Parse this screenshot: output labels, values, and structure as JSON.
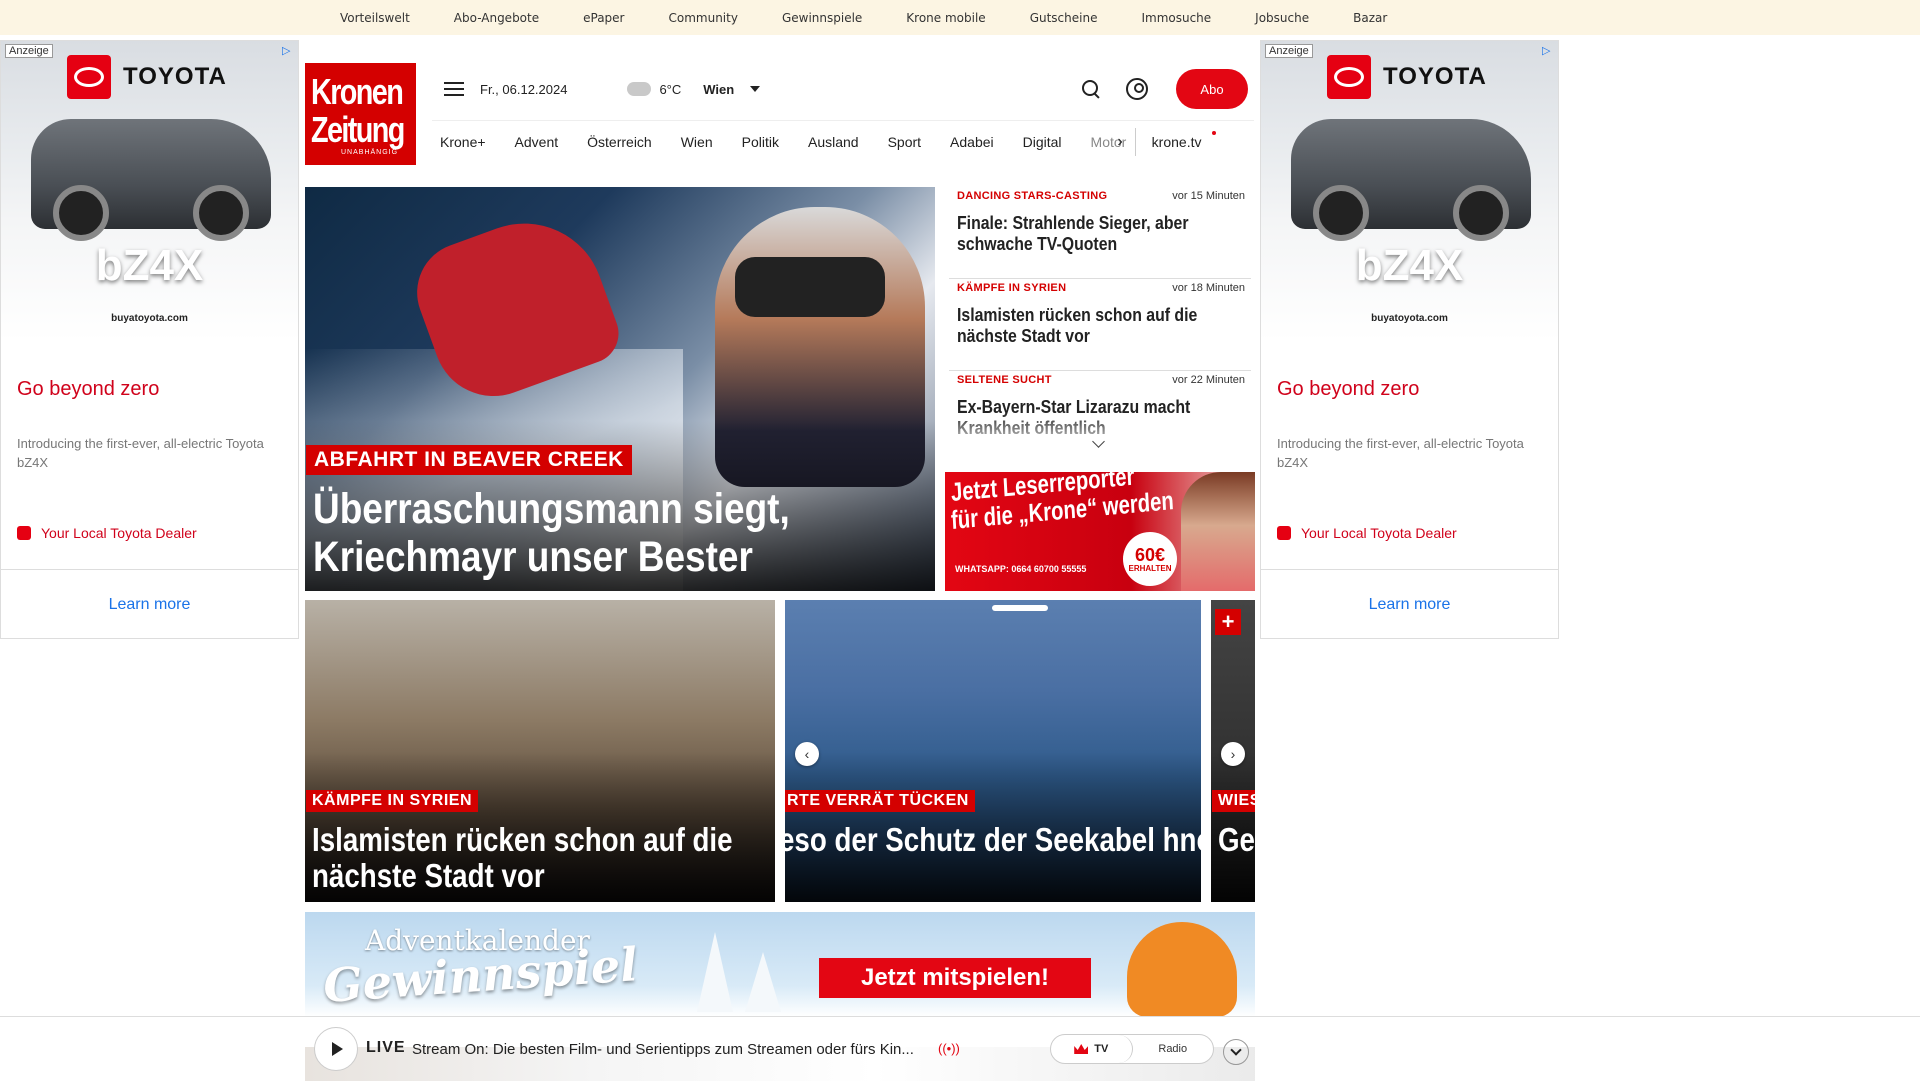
{
  "topbar": {
    "links": [
      "Vorteilswelt",
      "Abo-Angebote",
      "ePaper",
      "Community",
      "Gewinnspiele",
      "Krone mobile",
      "Gutscheine",
      "Immosuche",
      "Jobsuche",
      "Bazar"
    ]
  },
  "ad": {
    "label": "Anzeige",
    "brand": "TOYOTA",
    "model": "bZ4X",
    "url_text": "buyatoyota.com",
    "headline": "Go beyond zero",
    "description": "Introducing the first-ever, all-electric Toyota bZ4X",
    "dealer": "Your Local Toyota Dealer",
    "cta": "Learn more"
  },
  "header": {
    "logo_line1": "Kronen",
    "logo_line2": "Zeitung",
    "logo_tagline": "UNABHÄNGIG",
    "date": "Fr., 06.12.2024",
    "temperature": "6°C",
    "city": "Wien",
    "abo_label": "Abo"
  },
  "nav": {
    "items": [
      "Krone+",
      "Advent",
      "Österreich",
      "Wien",
      "Politik",
      "Ausland",
      "Sport",
      "Adabei",
      "Digital"
    ],
    "truncated": "Motor",
    "tv": "krone.tv"
  },
  "hero": {
    "kicker": "ABFAHRT IN BEAVER CREEK",
    "title": "Überraschungsmann siegt, Kriechmayr unser Bester"
  },
  "side_news": [
    {
      "category": "DANCING STARS-CASTING",
      "time": "vor 15 Minuten",
      "title": "Finale: Strahlende Sieger, aber schwache TV-Quoten"
    },
    {
      "category": "KÄMPFE IN SYRIEN",
      "time": "vor 18 Minuten",
      "title": "Islamisten rücken schon auf die nächste Stadt vor"
    },
    {
      "category": "SELTENE SUCHT",
      "time": "vor 22 Minuten",
      "title": "Ex-Bayern-Star Lizarazu macht Krankheit öffentlich"
    }
  ],
  "promo": {
    "line1": "Jetzt Leserreporter",
    "line2": "für die „Krone“ werden",
    "whatsapp": "WHATSAPP: 0664 60700 55555",
    "badge_amount": "60€",
    "badge_text": "ERHALTEN"
  },
  "cards": [
    {
      "kicker": "KÄMPFE IN SYRIEN",
      "title": "Islamisten rücken schon auf die nächste Stadt vor"
    },
    {
      "kicker": "RTE VERRÄT TÜCKEN",
      "title": "eso der Schutz der Seekabel hnologisch ein Albtraum ist"
    },
    {
      "kicker": "WIES",
      "title": "Ge Wi"
    }
  ],
  "carousel": {
    "prev": "‹",
    "next": "›",
    "plus": "+"
  },
  "advent": {
    "line1": "Adventkalender",
    "line2": "Gewinnspiel",
    "cta": "Jetzt mitspielen!"
  },
  "player": {
    "live": "LIVE",
    "stream": "Stream On: Die besten Film- und Serientipps zum Streamen oder fürs Kin...",
    "onair_icon": "((•))",
    "tv": "TV",
    "radio": "Radio"
  },
  "colors": {
    "brand_red": "#d40000",
    "abo_red": "#e30613",
    "topbar_bg": "#fcf5e3",
    "ad_red": "#d0021b",
    "ad_link": "#1a73e8"
  },
  "icons": [
    "menu-icon",
    "cloud-icon",
    "chevron-down-icon",
    "search-icon",
    "user-icon",
    "chevron-right-icon",
    "play-icon",
    "crown-icon",
    "broadcast-icon",
    "adchoices-icon",
    "toyota-logo-icon"
  ]
}
